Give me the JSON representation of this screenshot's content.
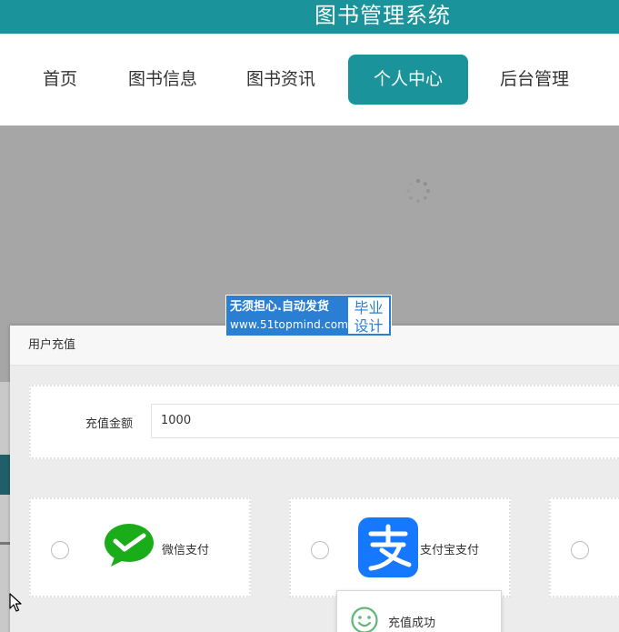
{
  "header": {
    "title": "图书管理系统",
    "color": "#1a939b"
  },
  "nav": {
    "items": [
      {
        "label": "首页",
        "active": false
      },
      {
        "label": "图书信息",
        "active": false
      },
      {
        "label": "图书资讯",
        "active": false
      },
      {
        "label": "个人中心",
        "active": true
      },
      {
        "label": "后台管理",
        "active": false
      }
    ]
  },
  "watermark": {
    "text": "无须担心.自动发货",
    "url": "www.51topmind.com",
    "badge_line1": "毕业",
    "badge_line2": "设计"
  },
  "dialog": {
    "title": "用户充值",
    "amount_label": "充值金额",
    "amount_value": "1000",
    "payment_methods": [
      {
        "label": "微信支付",
        "icon": "wechat-pay-icon",
        "color": "#1aad19"
      },
      {
        "label": "支付宝支付",
        "icon": "alipay-icon",
        "color": "#1677ff"
      },
      {
        "label": "",
        "icon": "",
        "color": ""
      }
    ]
  },
  "toast": {
    "message": "充值成功",
    "icon": "smile-icon",
    "color": "#5fb878"
  },
  "icons": {
    "loading": "loading-spinner-icon",
    "cursor": "mouse-cursor-icon"
  }
}
